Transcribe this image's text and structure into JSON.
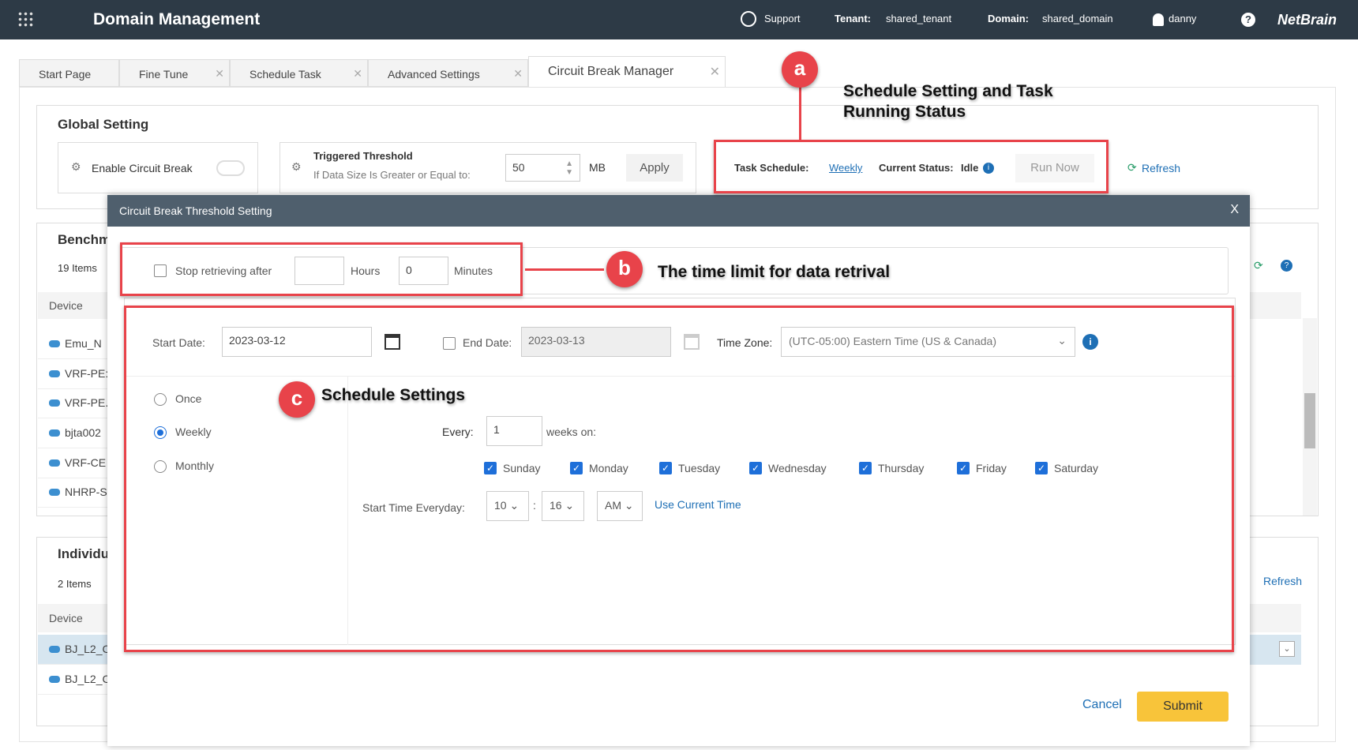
{
  "header": {
    "title": "Domain Management",
    "support": "Support",
    "tenant_label": "Tenant:",
    "tenant": "shared_tenant",
    "domain_label": "Domain:",
    "domain": "shared_domain",
    "user": "danny",
    "help": "?",
    "logo": "NetBrain"
  },
  "tabs": [
    {
      "label": "Start Page"
    },
    {
      "label": "Fine Tune"
    },
    {
      "label": "Schedule Task"
    },
    {
      "label": "Advanced Settings"
    },
    {
      "label": "Circuit Break Manager"
    }
  ],
  "global": {
    "title": "Global Setting",
    "enable_label": "Enable Circuit Break",
    "threshold_title": "Triggered Threshold",
    "threshold_desc": "If Data Size Is Greater or Equal to:",
    "threshold_value": "50",
    "unit": "MB",
    "apply": "Apply",
    "task_schedule_label": "Task Schedule:",
    "task_schedule_value": "Weekly",
    "status_label": "Current Status:",
    "status_value": "Idle",
    "run_now": "Run Now",
    "refresh": "Refresh"
  },
  "bench": {
    "title": "Benchm",
    "count": "19 Items",
    "col": "Device",
    "rows": [
      "Emu_N",
      "VRF-PE:",
      "VRF-PE.",
      "bjta002",
      "VRF-CE",
      "NHRP-S"
    ]
  },
  "indiv": {
    "title": "Individu",
    "count": "2 Items",
    "col": "Device",
    "rows": [
      "BJ_L2_C",
      "BJ_L2_C"
    ],
    "refresh": "Refresh"
  },
  "dialog": {
    "title": "Circuit Break Threshold Setting",
    "close": "X",
    "stop_label": "Stop retrieving after",
    "hours_value": "",
    "hours_label": "Hours",
    "minutes_value": "0",
    "minutes_label": "Minutes",
    "start_date_label": "Start Date:",
    "start_date": "2023-03-12",
    "end_date_label": "End Date:",
    "end_date": "2023-03-13",
    "tz_label": "Time Zone:",
    "tz_value": "(UTC-05:00) Eastern Time (US & Canada)",
    "freq": [
      "Once",
      "Weekly",
      "Monthly"
    ],
    "every_label": "Every:",
    "every_value": "1",
    "weeks_on": "weeks on:",
    "days": [
      "Sunday",
      "Monday",
      "Tuesday",
      "Wednesday",
      "Thursday",
      "Friday",
      "Saturday"
    ],
    "start_time_label": "Start Time Everyday:",
    "hour": "10",
    "minute": "16",
    "ampm": "AM",
    "use_current": "Use Current Time",
    "cancel": "Cancel",
    "submit": "Submit"
  },
  "annotations": {
    "a": {
      "badge": "a",
      "text": "Schedule Setting and Task Running Status"
    },
    "b": {
      "badge": "b",
      "text": "The time limit for data retrival"
    },
    "c": {
      "badge": "c",
      "text": "Schedule Settings"
    }
  }
}
